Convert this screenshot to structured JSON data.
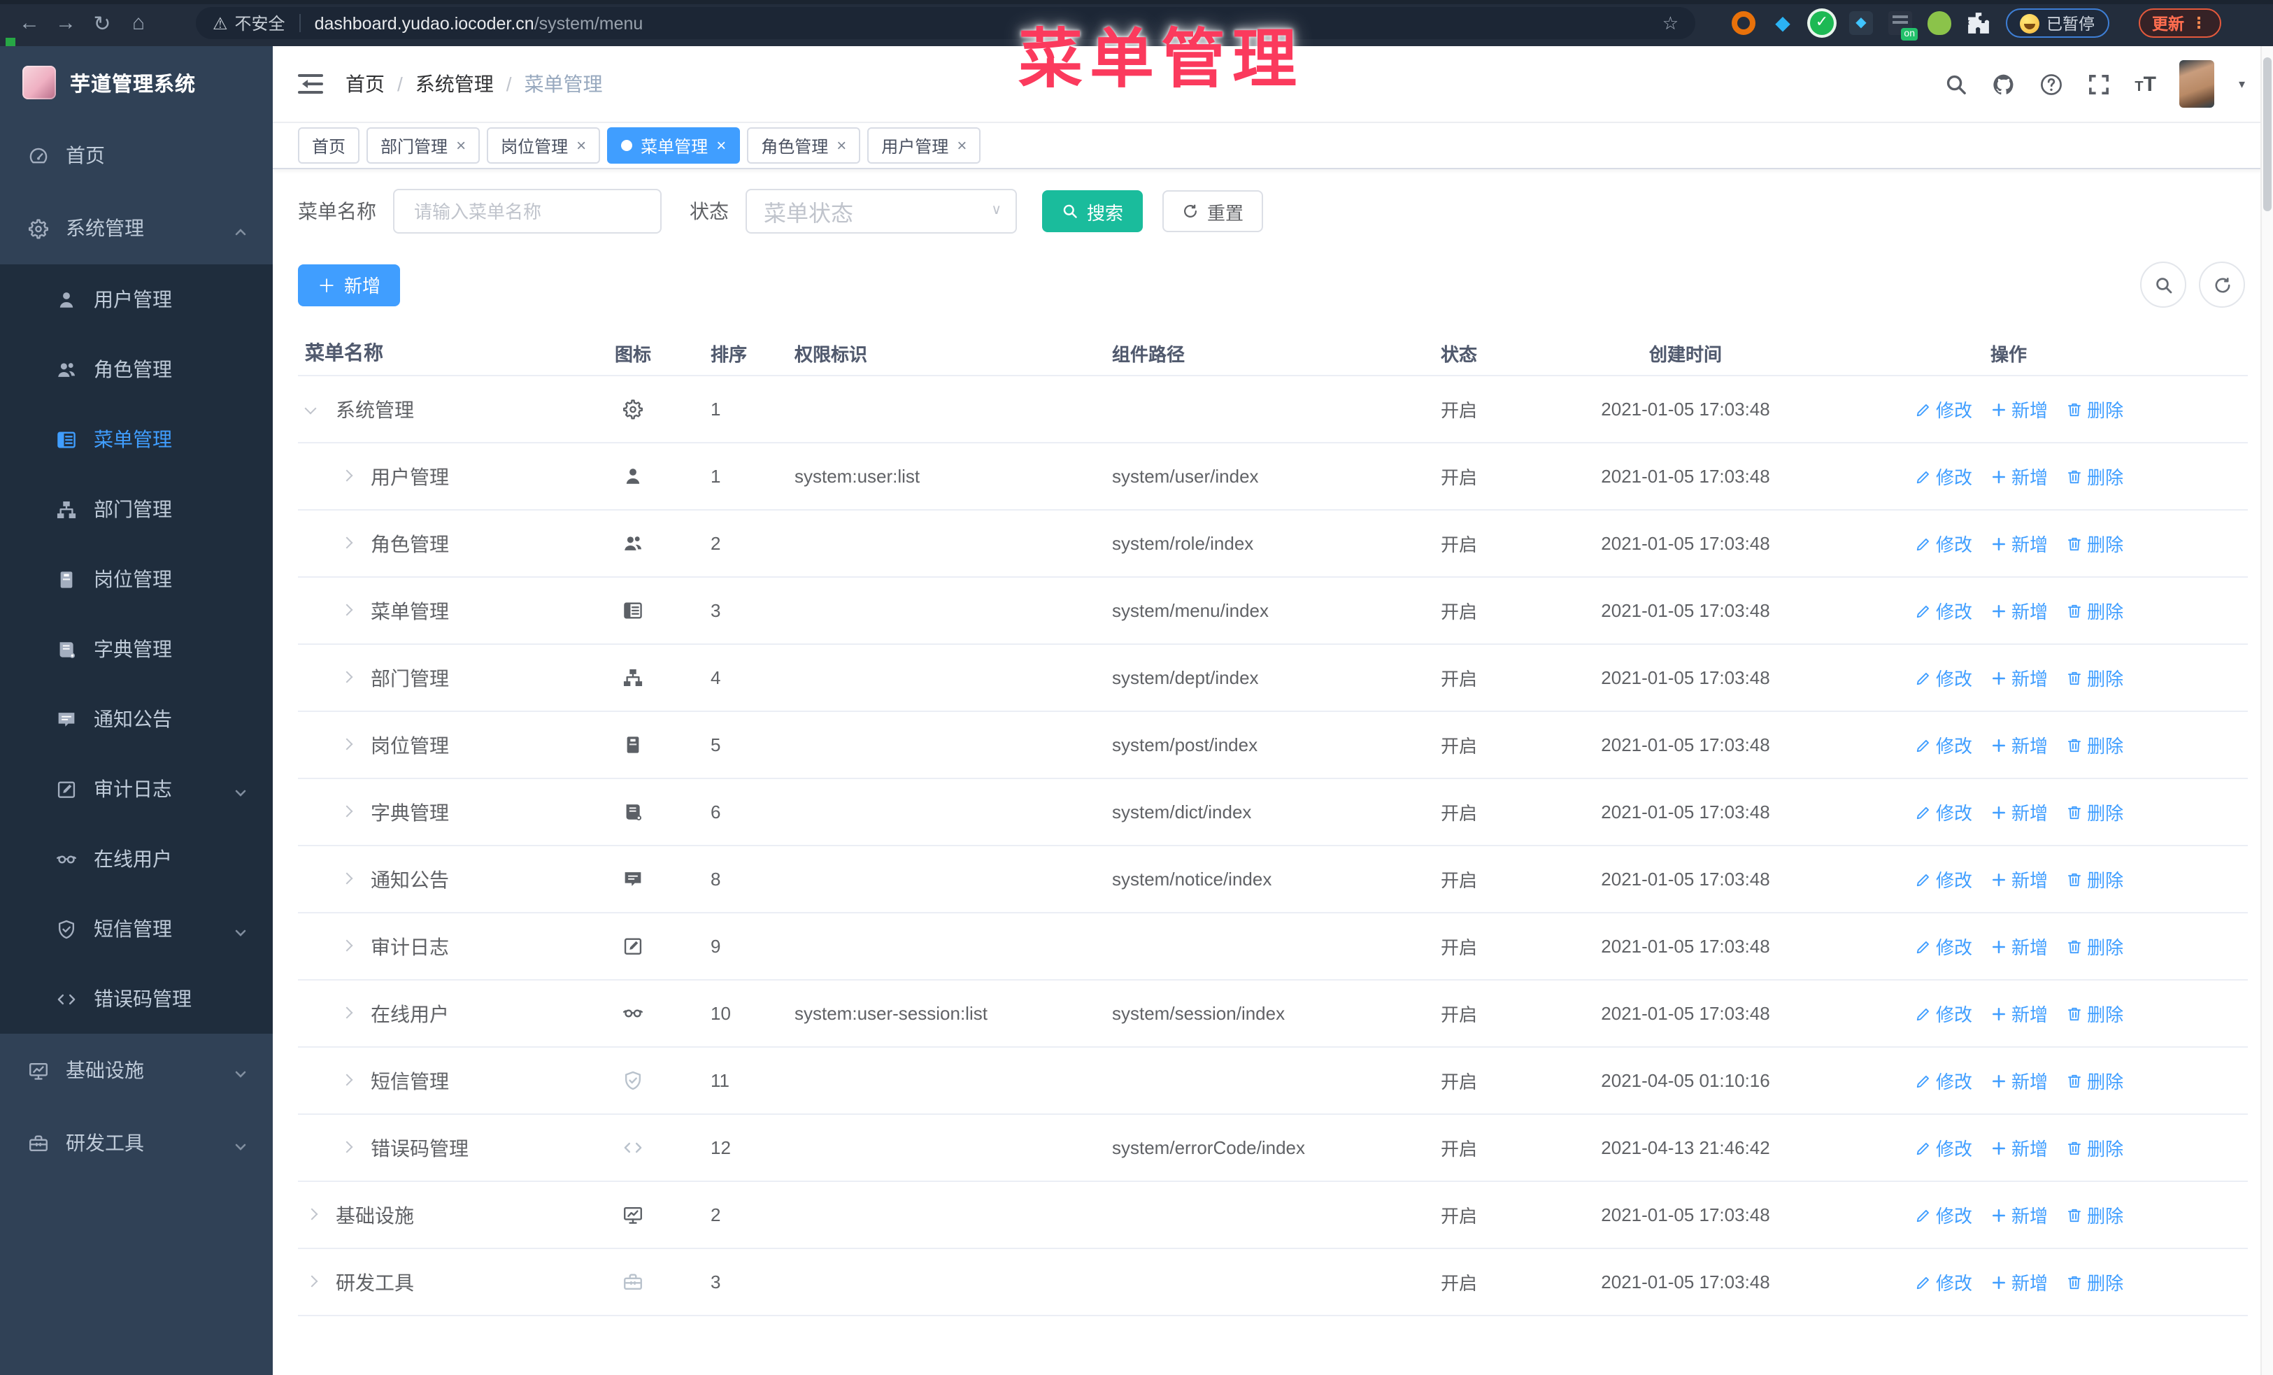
{
  "colors": {
    "accent": "#409eff",
    "teal": "#1abc9c",
    "sidebar_bg": "#304156",
    "submenu_bg": "#1f2d3d",
    "chrome_bg": "#232d3c",
    "overlay_pink": "#fb3a5d",
    "status_text": "#606266",
    "link": "#409eff"
  },
  "glyphs": {
    "back": "←",
    "forward": "→",
    "reload": "↻",
    "home": "⌂",
    "warning": "⚠",
    "star": "☆",
    "gem": "◆",
    "check": "✓",
    "grid_diamond": "◆",
    "on_badge": "on",
    "dots": "⋮",
    "close": "×",
    "caret_down": "▾",
    "plus": "＋",
    "slash": "/",
    "question": "?",
    "font_big": "T",
    "font_small": "T"
  },
  "overlay": {
    "title": "菜单管理"
  },
  "browser": {
    "security_label": "不安全",
    "url_host": "dashboard.yudao.iocoder.cn",
    "url_path": "/system/menu",
    "paused_label": "已暂停",
    "update_label": "更新"
  },
  "sidebar": {
    "logo_title": "芋道管理系统",
    "items": [
      {
        "label": "首页",
        "icon": "dashboard",
        "variant": "root"
      },
      {
        "label": "系统管理",
        "icon": "gear",
        "variant": "root",
        "caret": "up"
      },
      {
        "label": "用户管理",
        "icon": "user",
        "variant": "sub"
      },
      {
        "label": "角色管理",
        "icon": "users",
        "variant": "sub"
      },
      {
        "label": "菜单管理",
        "icon": "menu",
        "variant": "sub",
        "active": true
      },
      {
        "label": "部门管理",
        "icon": "tree",
        "variant": "sub"
      },
      {
        "label": "岗位管理",
        "icon": "badge",
        "variant": "sub"
      },
      {
        "label": "字典管理",
        "icon": "book",
        "variant": "sub"
      },
      {
        "label": "通知公告",
        "icon": "message",
        "variant": "sub"
      },
      {
        "label": "审计日志",
        "icon": "edit",
        "variant": "sub",
        "caret": "down"
      },
      {
        "label": "在线用户",
        "icon": "goggles",
        "variant": "sub"
      },
      {
        "label": "短信管理",
        "icon": "shield",
        "variant": "sub",
        "caret": "down"
      },
      {
        "label": "错误码管理",
        "icon": "code",
        "variant": "sub"
      },
      {
        "label": "基础设施",
        "icon": "monitor",
        "variant": "root",
        "caret": "down"
      },
      {
        "label": "研发工具",
        "icon": "toolbox",
        "variant": "root",
        "caret": "down"
      }
    ]
  },
  "header": {
    "breadcrumb": [
      "首页",
      "系统管理",
      "菜单管理"
    ]
  },
  "tabs": [
    {
      "label": "首页",
      "closable": false,
      "active": false
    },
    {
      "label": "部门管理",
      "closable": true,
      "active": false
    },
    {
      "label": "岗位管理",
      "closable": true,
      "active": false
    },
    {
      "label": "菜单管理",
      "closable": true,
      "active": true
    },
    {
      "label": "角色管理",
      "closable": true,
      "active": false
    },
    {
      "label": "用户管理",
      "closable": true,
      "active": false
    }
  ],
  "filters": {
    "name_label": "菜单名称",
    "name_placeholder": "请输入菜单名称",
    "status_label": "状态",
    "status_placeholder": "菜单状态",
    "search_label": "搜索",
    "reset_label": "重置"
  },
  "toolbar": {
    "add_label": "新增"
  },
  "table": {
    "columns": [
      "菜单名称",
      "图标",
      "排序",
      "权限标识",
      "组件路径",
      "状态",
      "创建时间",
      "操作"
    ],
    "ops": {
      "edit": "修改",
      "add": "新增",
      "delete": "删除"
    },
    "rows": [
      {
        "name": "系统管理",
        "level": 0,
        "expanded": true,
        "icon": "gear",
        "sort": "1",
        "perm": "",
        "path": "",
        "status": "开启",
        "time": "2021-01-05 17:03:48"
      },
      {
        "name": "用户管理",
        "level": 1,
        "icon": "user",
        "sort": "1",
        "perm": "system:user:list",
        "path": "system/user/index",
        "status": "开启",
        "time": "2021-01-05 17:03:48"
      },
      {
        "name": "角色管理",
        "level": 1,
        "icon": "users",
        "sort": "2",
        "perm": "",
        "path": "system/role/index",
        "status": "开启",
        "time": "2021-01-05 17:03:48"
      },
      {
        "name": "菜单管理",
        "level": 1,
        "icon": "menu",
        "sort": "3",
        "perm": "",
        "path": "system/menu/index",
        "status": "开启",
        "time": "2021-01-05 17:03:48"
      },
      {
        "name": "部门管理",
        "level": 1,
        "icon": "tree",
        "sort": "4",
        "perm": "",
        "path": "system/dept/index",
        "status": "开启",
        "time": "2021-01-05 17:03:48"
      },
      {
        "name": "岗位管理",
        "level": 1,
        "icon": "badge",
        "sort": "5",
        "perm": "",
        "path": "system/post/index",
        "status": "开启",
        "time": "2021-01-05 17:03:48"
      },
      {
        "name": "字典管理",
        "level": 1,
        "icon": "book",
        "sort": "6",
        "perm": "",
        "path": "system/dict/index",
        "status": "开启",
        "time": "2021-01-05 17:03:48"
      },
      {
        "name": "通知公告",
        "level": 1,
        "icon": "message",
        "sort": "8",
        "perm": "",
        "path": "system/notice/index",
        "status": "开启",
        "time": "2021-01-05 17:03:48"
      },
      {
        "name": "审计日志",
        "level": 1,
        "icon": "edit",
        "sort": "9",
        "perm": "",
        "path": "",
        "status": "开启",
        "time": "2021-01-05 17:03:48"
      },
      {
        "name": "在线用户",
        "level": 1,
        "icon": "goggles",
        "sort": "10",
        "perm": "system:user-session:list",
        "path": "system/session/index",
        "status": "开启",
        "time": "2021-01-05 17:03:48"
      },
      {
        "name": "短信管理",
        "level": 1,
        "icon": "shield",
        "dim": true,
        "sort": "11",
        "perm": "",
        "path": "",
        "status": "开启",
        "time": "2021-04-05 01:10:16"
      },
      {
        "name": "错误码管理",
        "level": 1,
        "icon": "code",
        "dim": true,
        "sort": "12",
        "perm": "",
        "path": "system/errorCode/index",
        "status": "开启",
        "time": "2021-04-13 21:46:42"
      },
      {
        "name": "基础设施",
        "level": 0,
        "icon": "monitor",
        "sort": "2",
        "perm": "",
        "path": "",
        "status": "开启",
        "time": "2021-01-05 17:03:48"
      },
      {
        "name": "研发工具",
        "level": 0,
        "icon": "toolbox",
        "dim": true,
        "sort": "3",
        "perm": "",
        "path": "",
        "status": "开启",
        "time": "2021-01-05 17:03:48"
      }
    ]
  }
}
